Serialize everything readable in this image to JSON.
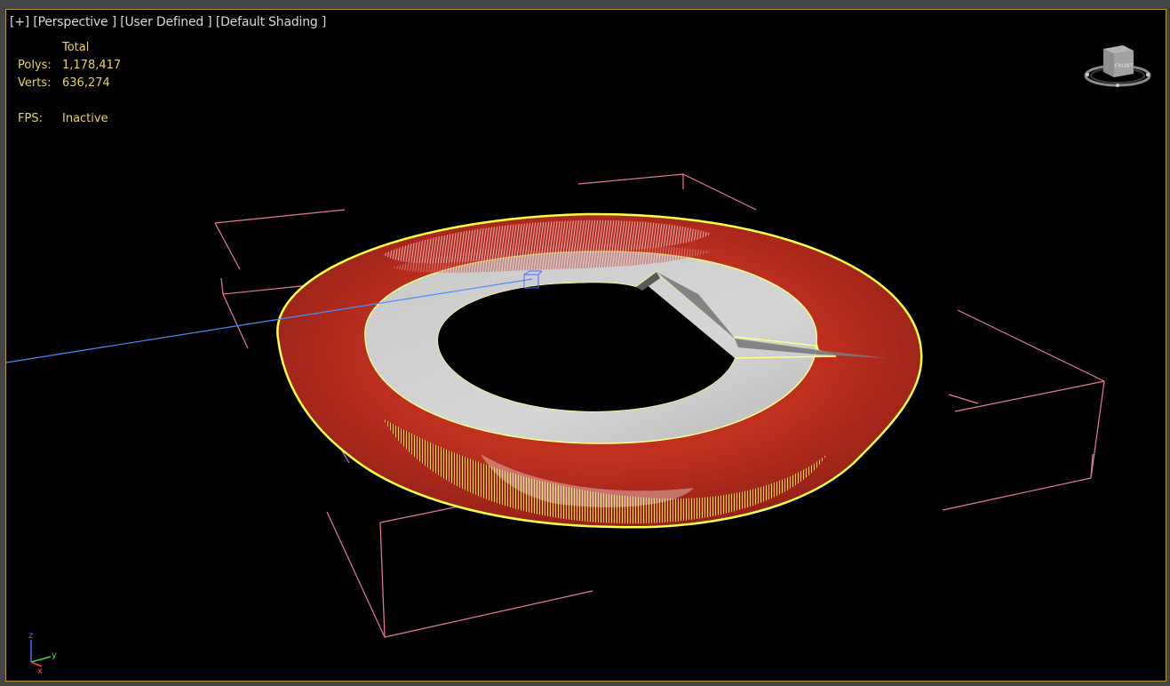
{
  "viewport": {
    "menu_plus": "[+]",
    "view_mode": "[Perspective ]",
    "shading_preset": "[User Defined ]",
    "shading_mode": "[Default Shading ]"
  },
  "stats": {
    "header": "Total",
    "polys_label": "Polys:",
    "polys_value": "1,178,417",
    "verts_label": "Verts:",
    "verts_value": "636,274",
    "fps_label": "FPS:",
    "fps_value": "Inactive"
  },
  "viewcube": {
    "face_label": "FRONT"
  },
  "axis": {
    "z": "z",
    "y": "y",
    "x": "x"
  },
  "colors": {
    "viewport_bg": "#000000",
    "viewport_border": "#b59a2a",
    "stats_text": "#e8d35a",
    "label_text": "#d8d8d8",
    "ring_red": "#b52a20",
    "ring_highlight": "#ffff44",
    "disc_gray": "#cfcfcf",
    "bbox_pink": "#e87b9c",
    "guide_blue": "#4a8cff"
  }
}
